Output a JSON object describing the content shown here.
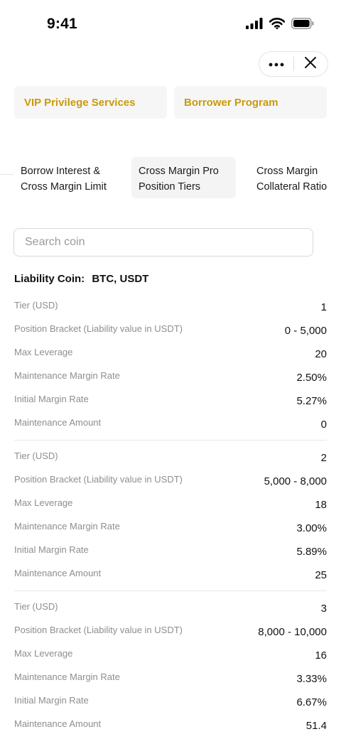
{
  "status_bar": {
    "time": "9:41"
  },
  "programs": [
    {
      "label": "VIP Privilege Services"
    },
    {
      "label": "Borrower Program"
    }
  ],
  "tabs": [
    {
      "line1": "Borrow Interest &",
      "line2": "Cross Margin Limit",
      "active": false
    },
    {
      "line1": "Cross Margin Pro",
      "line2": "Position Tiers",
      "active": true
    },
    {
      "line1": "Cross Margin",
      "line2": "Collateral Ratio",
      "active": false
    }
  ],
  "search": {
    "placeholder": "Search coin",
    "value": ""
  },
  "liability": {
    "label": "Liability Coin:",
    "value": "BTC, USDT"
  },
  "row_labels": {
    "tier": "Tier (USD)",
    "bracket": "Position Bracket (Liability value in USDT)",
    "leverage": "Max Leverage",
    "mmr": "Maintenance Margin Rate",
    "imr": "Initial Margin Rate",
    "amount": "Maintenance Amount"
  },
  "tiers": [
    {
      "tier": "1",
      "bracket": "0 - 5,000",
      "leverage": "20",
      "mmr": "2.50%",
      "imr": "5.27%",
      "amount": "0"
    },
    {
      "tier": "2",
      "bracket": "5,000 - 8,000",
      "leverage": "18",
      "mmr": "3.00%",
      "imr": "5.89%",
      "amount": "25"
    },
    {
      "tier": "3",
      "bracket": "8,000 - 10,000",
      "leverage": "16",
      "mmr": "3.33%",
      "imr": "6.67%",
      "amount": "51.4"
    }
  ],
  "colors": {
    "accent": "#c99a0c",
    "card_bg": "#f6f6f6",
    "label_gray": "#8e8e8e"
  },
  "icons": [
    "signal-icon",
    "wifi-icon",
    "battery-icon",
    "more-icon",
    "close-icon"
  ]
}
